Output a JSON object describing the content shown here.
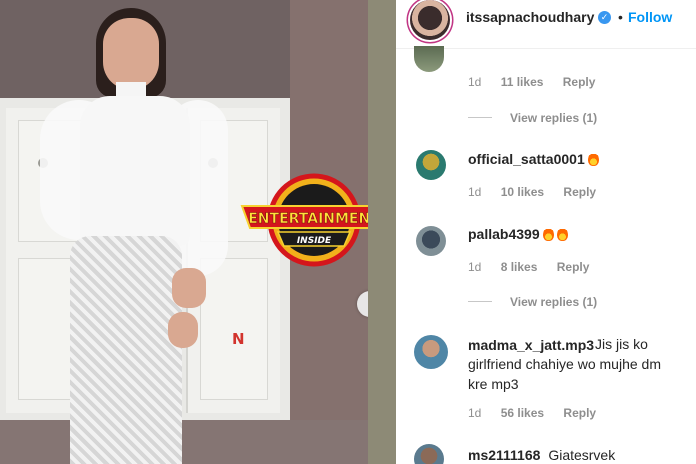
{
  "post": {
    "username": "itssapnachoudhary",
    "separator": "•",
    "follow_label": "Follow",
    "verified_icon": "check-icon",
    "accent_color": "#0095f6"
  },
  "watermark": {
    "logo_line1": "ENTERTAINMENT",
    "logo_line2": "INSIDE",
    "corner_mark": "N"
  },
  "comments": [
    {
      "id": "partial",
      "age": "1d",
      "likes": "11 likes",
      "reply": "Reply",
      "view_replies": "View replies (1)"
    },
    {
      "id": "c1",
      "username": "official_satta0001",
      "emoji": "fire",
      "age": "1d",
      "likes": "10 likes",
      "reply": "Reply"
    },
    {
      "id": "c2",
      "username": "pallab4399",
      "emoji": "fire fire",
      "age": "1d",
      "likes": "8 likes",
      "reply": "Reply",
      "view_replies": "View replies (1)"
    },
    {
      "id": "c3",
      "username": "madma_x_jatt.mp3",
      "text": "Jis jis ko girlfriend chahiye wo mujhe dm kre mp3",
      "line1": "Jis jis ko",
      "line2": "girlfriend chahiye wo mujhe dm",
      "line3": "kre mp3",
      "age": "1d",
      "likes": "56 likes",
      "reply": "Reply"
    },
    {
      "id": "c4",
      "username": "ms2111168",
      "text": "Giatesrvek"
    }
  ]
}
